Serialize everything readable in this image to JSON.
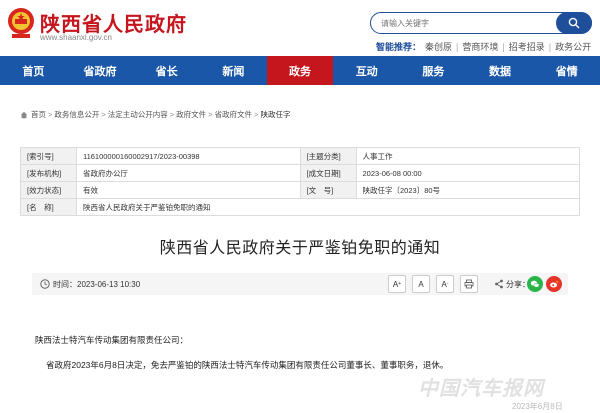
{
  "header": {
    "site_title": "陕西省人民政府",
    "site_domain": "www.shaanxi.gov.cn",
    "search_placeholder": "请输入关键字",
    "smart_rec_label": "智能推荐：",
    "smart_rec_items": [
      "秦创原",
      "营商环境",
      "招考招录",
      "政务公开"
    ]
  },
  "nav": {
    "items": [
      "首页",
      "省政府",
      "省长",
      "新闻",
      "政务",
      "互动",
      "服务",
      "数据",
      "省情"
    ],
    "active_index": 4
  },
  "breadcrumb": [
    "首页",
    "政务信息公开",
    "法定主动公开内容",
    "政府文件",
    "省政府文件",
    "陕政任字"
  ],
  "meta": {
    "rows": [
      [
        {
          "k": "[索引号]",
          "v": "116100000160002917/2023-00398"
        },
        {
          "k": "[主题分类]",
          "v": "人事工作"
        }
      ],
      [
        {
          "k": "[发布机构]",
          "v": "省政府办公厅"
        },
        {
          "k": "[成文日期]",
          "v": "2023-06-08 00:00"
        }
      ],
      [
        {
          "k": "[效力状态]",
          "v": "有效"
        },
        {
          "k": "[文　号]",
          "v": "陕政任字〔2023〕80号"
        }
      ],
      [
        {
          "k": "[名　称]",
          "v": "陕西省人民政府关于严鉴铂免职的通知"
        }
      ]
    ]
  },
  "article": {
    "title": "陕西省人民政府关于严鉴铂免职的通知",
    "time_text": "时间：2023-06-13 10:30",
    "tools": [
      "A",
      "A",
      "A"
    ],
    "share_label": "分享：",
    "recipient": "陕西法士特汽车传动集团有限责任公司：",
    "body": "省政府2023年6月8日决定，免去严鉴铂的陕西法士特汽车传动集团有限责任公司董事长、董事职务，退休。",
    "footer_date": "2023年6月8日"
  },
  "watermark": "中国汽车报网",
  "colors": {
    "brand_red": "#c4161c",
    "nav_blue": "#1a57a8",
    "search_blue": "#1f4e9b",
    "wechat_green": "#2bb44a",
    "weibo_red": "#e6342b"
  }
}
